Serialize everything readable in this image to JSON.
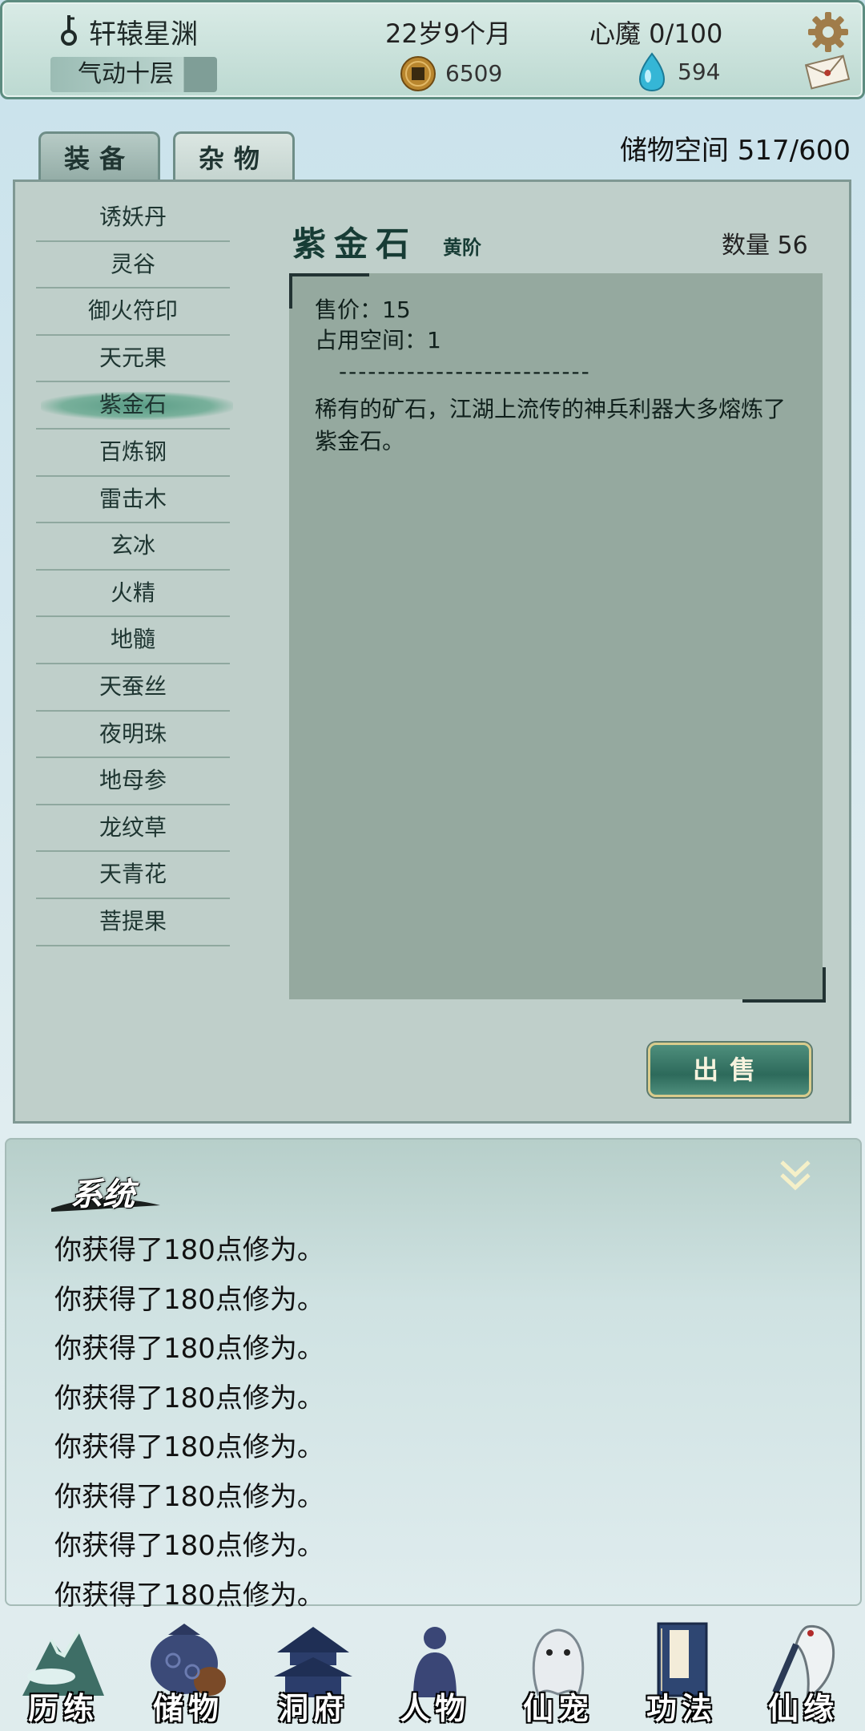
{
  "status": {
    "name": "轩辕星渊",
    "realm": "气动十层",
    "age": "22岁9个月",
    "demon": "心魔  0/100",
    "coins": "6509",
    "gems": "594",
    "icons": [
      "key-icon",
      "gear-icon",
      "coin-icon",
      "gem-icon",
      "mail-icon"
    ]
  },
  "tabs": [
    {
      "label": "装备",
      "active": false
    },
    {
      "label": "杂物",
      "active": true
    }
  ],
  "storage": "储物空间  517/600",
  "items": [
    "诱妖丹",
    "灵谷",
    "御火符印",
    "天元果",
    "紫金石",
    "百炼钢",
    "雷击木",
    "玄冰",
    "火精",
    "地髓",
    "天蚕丝",
    "夜明珠",
    "地母参",
    "龙纹草",
    "天青花",
    "菩提果"
  ],
  "selected_index": 4,
  "detail": {
    "name": "紫金石",
    "grade": "黄阶",
    "quantity": "数量 56",
    "price": "售价：15",
    "space": "占用空间：1",
    "divider": "--------------------------",
    "description": "稀有的矿石，江湖上流传的神兵利器大多熔炼了紫金石。"
  },
  "sell_label": "出售",
  "log": {
    "title": "系统",
    "lines": [
      "你获得了180点修为。",
      "你获得了180点修为。",
      "你获得了180点修为。",
      "你获得了180点修为。",
      "你获得了180点修为。",
      "你获得了180点修为。",
      "你获得了180点修为。",
      "你获得了180点修为。"
    ]
  },
  "nav": [
    "历练",
    "储物",
    "洞府",
    "人物",
    "仙宠",
    "功法",
    "仙缘"
  ],
  "colors": {
    "panel": "#bfcfca",
    "desc_box": "#95a99f",
    "accent": "#2d6a5b",
    "selected": "#6aa891"
  }
}
